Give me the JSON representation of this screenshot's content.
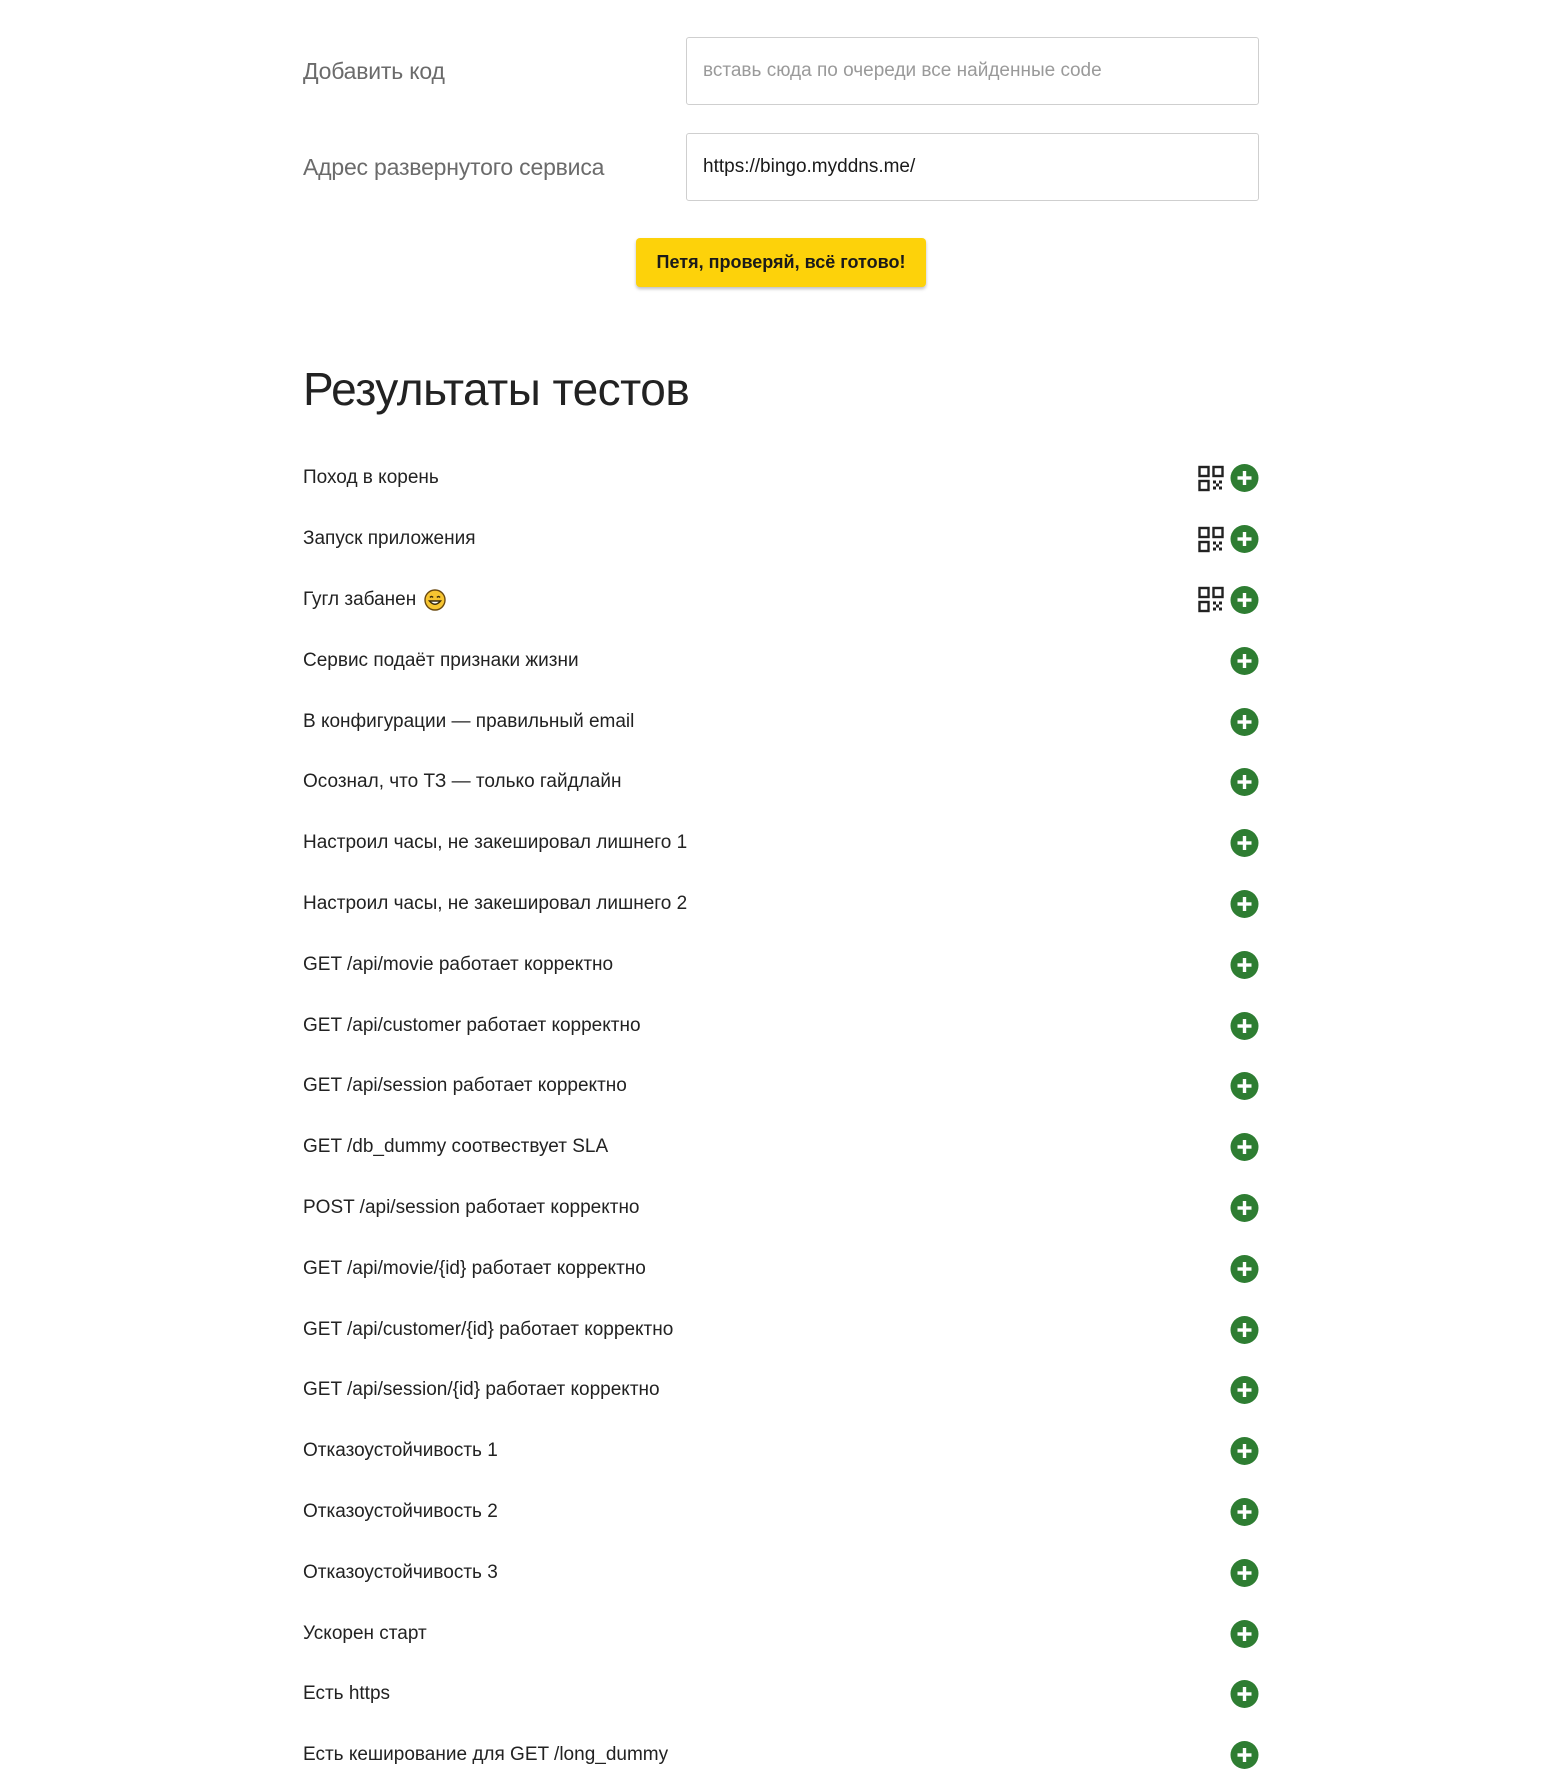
{
  "form": {
    "code_label": "Добавить код",
    "code_placeholder": "вставь сюда по очереди все найденные code",
    "service_label": "Адрес развернутого сервиса",
    "service_value": "https://bingo.myddns.me/",
    "submit_label": "Петя, проверяй, всё готово!"
  },
  "results": {
    "title": "Результаты тестов",
    "items": [
      {
        "label": "Поход в корень",
        "has_qr": true,
        "emoji": false
      },
      {
        "label": "Запуск приложения",
        "has_qr": true,
        "emoji": false
      },
      {
        "label": "Гугл забанен",
        "has_qr": true,
        "emoji": true
      },
      {
        "label": "Сервис подаёт признаки жизни",
        "has_qr": false,
        "emoji": false
      },
      {
        "label": "В конфигурации — правильный email",
        "has_qr": false,
        "emoji": false
      },
      {
        "label": "Осознал, что ТЗ — только гайдлайн",
        "has_qr": false,
        "emoji": false
      },
      {
        "label": "Настроил часы, не закешировал лишнего 1",
        "has_qr": false,
        "emoji": false
      },
      {
        "label": "Настроил часы, не закешировал лишнего 2",
        "has_qr": false,
        "emoji": false
      },
      {
        "label": "GET /api/movie работает корректно",
        "has_qr": false,
        "emoji": false
      },
      {
        "label": "GET /api/customer работает корректно",
        "has_qr": false,
        "emoji": false
      },
      {
        "label": "GET /api/session работает корректно",
        "has_qr": false,
        "emoji": false
      },
      {
        "label": "GET /db_dummy соотвествует SLA",
        "has_qr": false,
        "emoji": false
      },
      {
        "label": "POST /api/session работает корректно",
        "has_qr": false,
        "emoji": false
      },
      {
        "label": "GET /api/movie/{id} работает корректно",
        "has_qr": false,
        "emoji": false
      },
      {
        "label": "GET /api/customer/{id} работает корректно",
        "has_qr": false,
        "emoji": false
      },
      {
        "label": "GET /api/session/{id} работает корректно",
        "has_qr": false,
        "emoji": false
      },
      {
        "label": "Отказоустойчивость 1",
        "has_qr": false,
        "emoji": false
      },
      {
        "label": "Отказоустойчивость 2",
        "has_qr": false,
        "emoji": false
      },
      {
        "label": "Отказоустойчивость 3",
        "has_qr": false,
        "emoji": false
      },
      {
        "label": "Ускорен старт",
        "has_qr": false,
        "emoji": false
      },
      {
        "label": "Есть https",
        "has_qr": false,
        "emoji": false
      },
      {
        "label": "Есть кеширование для GET /long_dummy",
        "has_qr": false,
        "emoji": false
      }
    ]
  },
  "icons": {
    "qr": "qr-code-icon",
    "add": "plus-circle-icon",
    "emoji": "grinning-face-emoji"
  },
  "colors": {
    "button": "#fdd20a",
    "plus": "#2e7d32",
    "qr": "#222222",
    "emoji_face": "#f7c531"
  }
}
